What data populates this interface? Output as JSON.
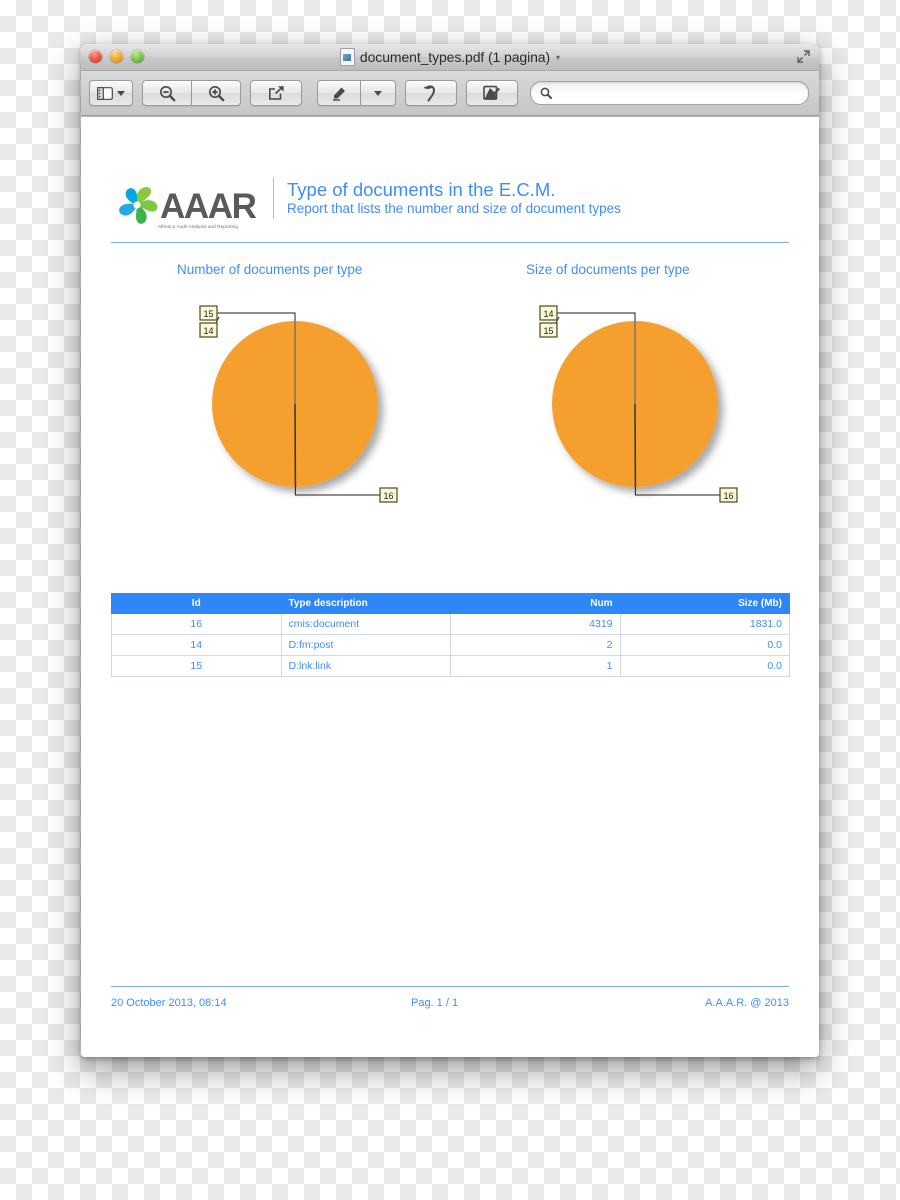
{
  "window": {
    "title": "document_types.pdf (1 pagina)",
    "title_caret": "▾",
    "traffic_lights": [
      "close",
      "minimize",
      "zoom"
    ],
    "fullscreen_icon": "fullscreen-icon"
  },
  "toolbar": {
    "sidebar_button": "sidebar-toggle",
    "sidebar_caret": "▾",
    "zoom_out": "zoom-out-icon",
    "zoom_in": "zoom-in-icon",
    "share": "share-icon",
    "highlight": "highlighter-icon",
    "highlight_caret": "▾",
    "rotate": "rotate-icon",
    "annotate": "annotate-icon",
    "search": {
      "icon": "search-icon",
      "value": "",
      "placeholder": ""
    }
  },
  "report": {
    "logo": {
      "wordmark": "AAAR",
      "tagline": "Alfresco Audit Analysis and Reporting"
    },
    "title": "Type of documents in the E.C.M.",
    "subtitle": "Report that lists the number and size of document types",
    "chart_titles": {
      "left": "Number of documents per type",
      "right": "Size of documents per type"
    },
    "table": {
      "columns": [
        "Id",
        "Type description",
        "Num",
        "Size (Mb)"
      ],
      "rows": [
        {
          "id": "16",
          "type": "cmis:document",
          "num": "4319",
          "size": "1831.0"
        },
        {
          "id": "14",
          "type": "D:fm:post",
          "num": "2",
          "size": "0.0"
        },
        {
          "id": "15",
          "type": "D:lnk:link",
          "num": "1",
          "size": "0.0"
        }
      ]
    },
    "footer": {
      "date": "20 October 2013, 08:14",
      "page": "Pag. 1 / 1",
      "copyright": "A.A.A.R. @ 2013"
    }
  },
  "colors": {
    "accent_blue": "#3e8ef7",
    "table_header": "#2f86f7",
    "pie_orange": "#f5a02f",
    "label_fill": "#fbf8d6",
    "label_border": "#5a5a2e"
  },
  "chart_data": [
    {
      "type": "pie",
      "title": "Number of documents per type",
      "labels": [
        "16",
        "14",
        "15"
      ],
      "categories": [
        "cmis:document",
        "D:fm:post",
        "D:lnk:link"
      ],
      "values": [
        4319,
        2,
        1
      ],
      "unit": "documents",
      "callout_order_top": [
        "15",
        "14"
      ],
      "callout_bottom": "16",
      "legend": "none",
      "grid": false
    },
    {
      "type": "pie",
      "title": "Size of documents per type",
      "labels": [
        "16",
        "14",
        "15"
      ],
      "categories": [
        "cmis:document",
        "D:fm:post",
        "D:lnk:link"
      ],
      "values": [
        1831.0,
        0.0,
        0.0
      ],
      "unit": "Mb",
      "callout_order_top": [
        "14",
        "15"
      ],
      "callout_bottom": "16",
      "legend": "none",
      "grid": false
    }
  ]
}
